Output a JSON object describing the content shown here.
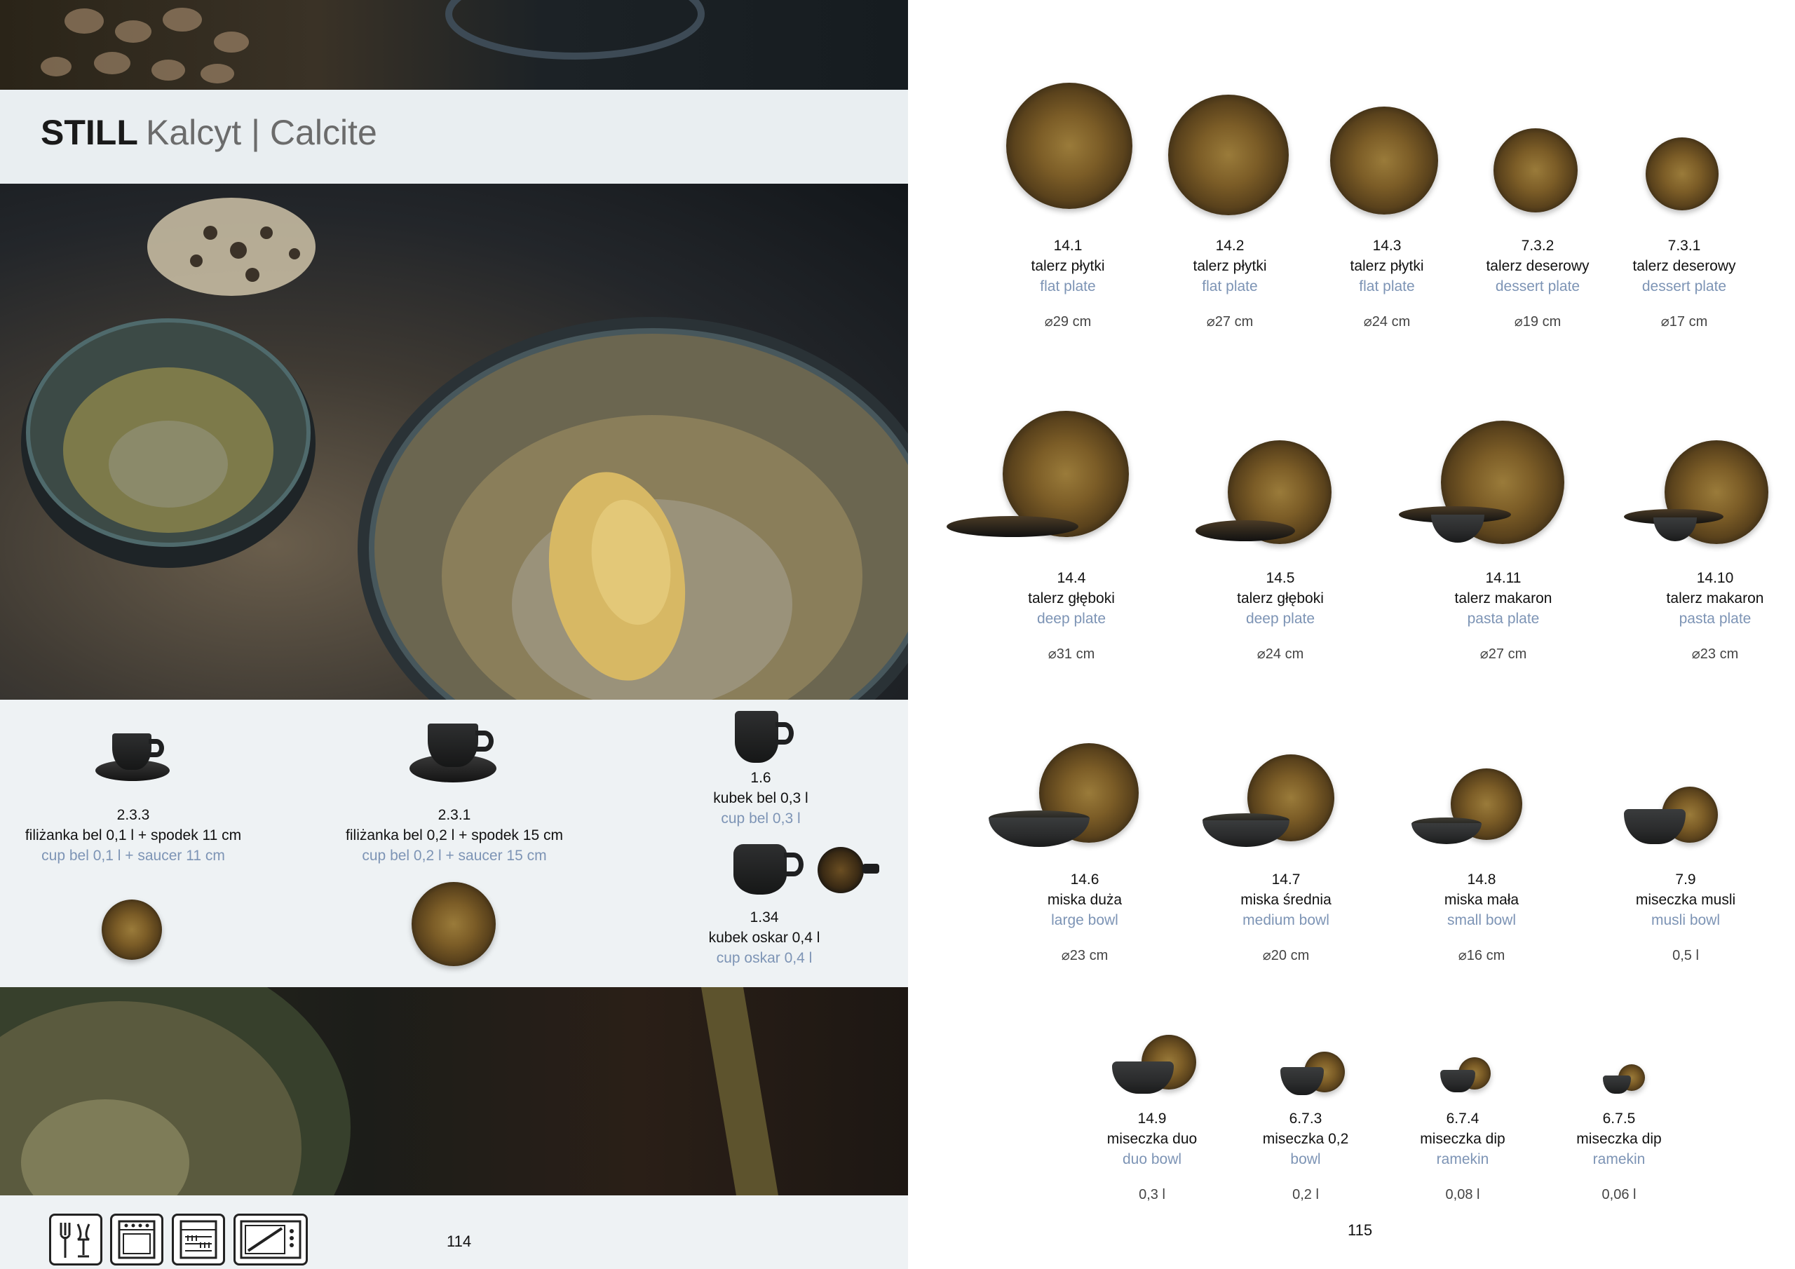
{
  "header": {
    "brand": "STILL",
    "subtitle": "Kalcyt | Calcite"
  },
  "left_items": [
    {
      "code": "2.3.3",
      "pl": "filiżanka bel 0,1 l + spodek 11 cm",
      "en": "cup bel 0,1 l + saucer 11 cm"
    },
    {
      "code": "2.3.1",
      "pl": "filiżanka bel 0,2 l + spodek 15 cm",
      "en": "cup bel 0,2 l + saucer 15 cm"
    },
    {
      "code": "1.6",
      "pl": "kubek bel 0,3 l",
      "en": "cup bel 0,3 l"
    },
    {
      "code": "1.34",
      "pl": "kubek oskar 0,4 l",
      "en": "cup oskar 0,4 l"
    }
  ],
  "row1": [
    {
      "code": "14.1",
      "pl": "talerz płytki",
      "en": "flat plate",
      "size": "⌀29 cm"
    },
    {
      "code": "14.2",
      "pl": "talerz płytki",
      "en": "flat plate",
      "size": "⌀27 cm"
    },
    {
      "code": "14.3",
      "pl": "talerz płytki",
      "en": "flat plate",
      "size": "⌀24 cm"
    },
    {
      "code": "7.3.2",
      "pl": "talerz deserowy",
      "en": "dessert plate",
      "size": "⌀19 cm"
    },
    {
      "code": "7.3.1",
      "pl": "talerz deserowy",
      "en": "dessert plate",
      "size": "⌀17 cm"
    }
  ],
  "row2": [
    {
      "code": "14.4",
      "pl": "talerz głęboki",
      "en": "deep plate",
      "size": "⌀31 cm"
    },
    {
      "code": "14.5",
      "pl": "talerz głęboki",
      "en": "deep plate",
      "size": "⌀24 cm"
    },
    {
      "code": "14.11",
      "pl": "talerz makaron",
      "en": "pasta plate",
      "size": "⌀27 cm"
    },
    {
      "code": "14.10",
      "pl": "talerz makaron",
      "en": "pasta plate",
      "size": "⌀23 cm"
    }
  ],
  "row3": [
    {
      "code": "14.6",
      "pl": "miska duża",
      "en": "large bowl",
      "size": "⌀23 cm"
    },
    {
      "code": "14.7",
      "pl": "miska średnia",
      "en": "medium bowl",
      "size": "⌀20 cm"
    },
    {
      "code": "14.8",
      "pl": "miska mała",
      "en": "small bowl",
      "size": "⌀16 cm"
    },
    {
      "code": "7.9",
      "pl": "miseczka musli",
      "en": "musli bowl",
      "size": "0,5 l"
    }
  ],
  "row4": [
    {
      "code": "14.9",
      "pl": "miseczka duo",
      "en": "duo bowl",
      "size": "0,3 l"
    },
    {
      "code": "6.7.3",
      "pl": "miseczka 0,2",
      "en": "bowl",
      "size": "0,2 l"
    },
    {
      "code": "6.7.4",
      "pl": "miseczka dip",
      "en": "ramekin",
      "size": "0,08 l"
    },
    {
      "code": "6.7.5",
      "pl": "miseczka dip",
      "en": "ramekin",
      "size": "0,06 l"
    }
  ],
  "footer": {
    "page_left": "114",
    "page_right": "115",
    "care_icons": [
      "food-safe-icon",
      "oven-safe-icon",
      "dishwasher-safe-icon",
      "microwave-safe-icon"
    ]
  }
}
